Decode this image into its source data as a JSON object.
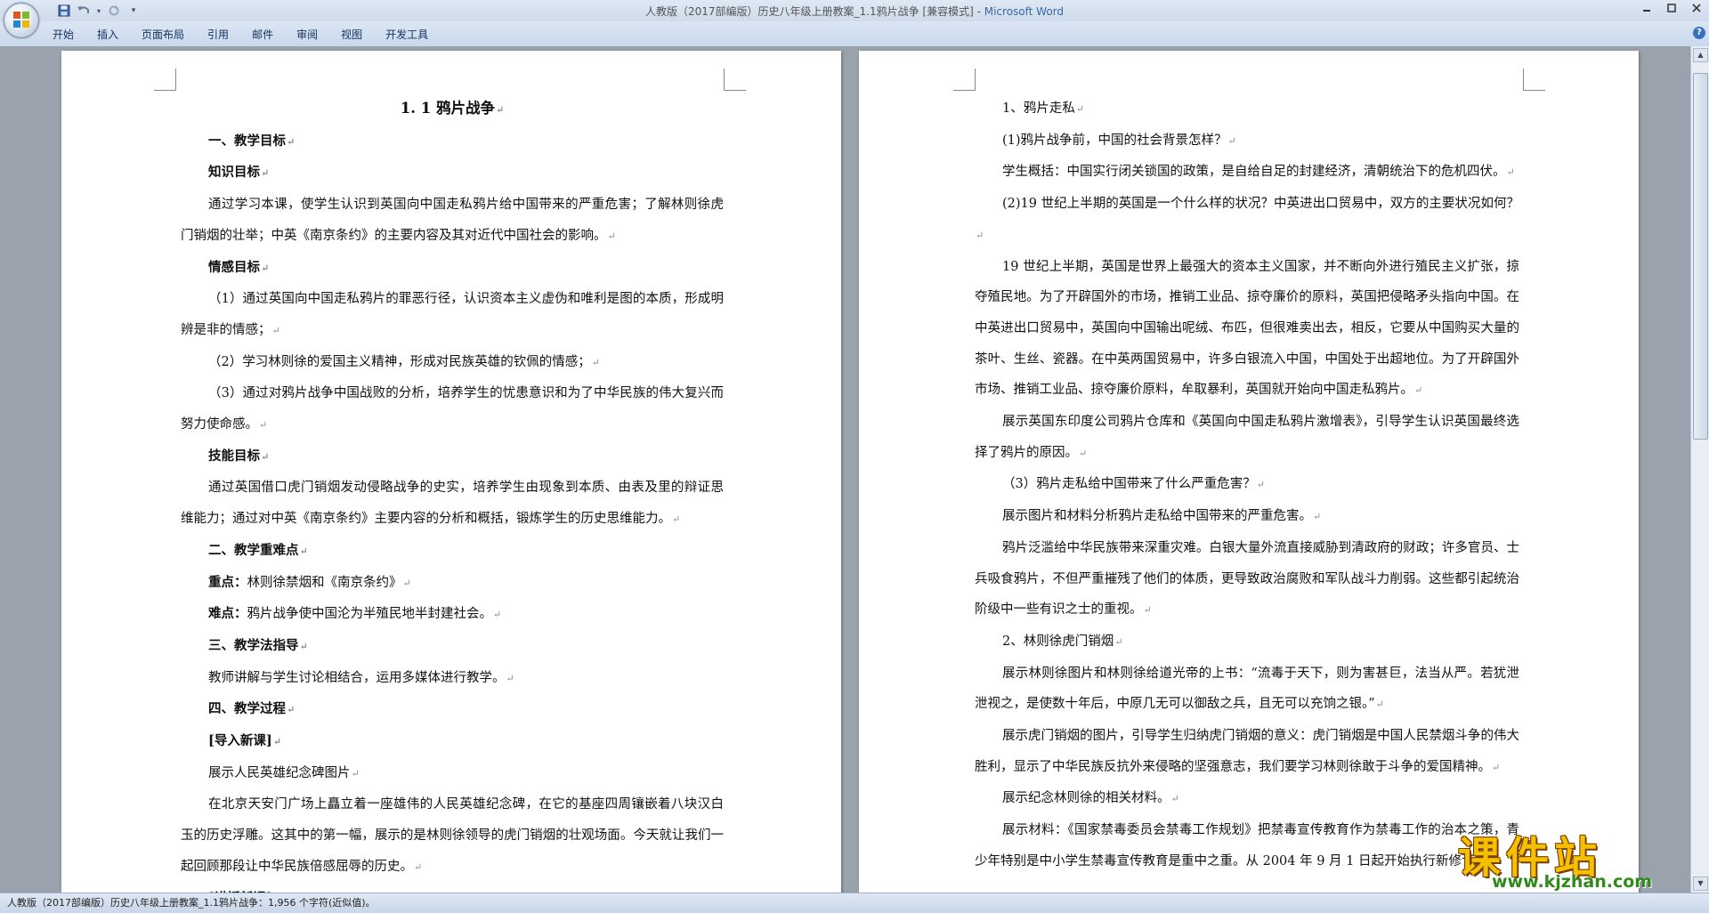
{
  "window": {
    "title_prefix": "人教版（2017部编版）历史八年级上册教案_1.1鸦片战争 [兼容模式] - ",
    "title_app": "Microsoft Word"
  },
  "ribbon": {
    "tabs": [
      "开始",
      "插入",
      "页面布局",
      "引用",
      "邮件",
      "审阅",
      "视图",
      "开发工具"
    ]
  },
  "icons": {
    "office_button": "office-logo-icon",
    "save": "save-icon",
    "undo": "undo-icon",
    "redo": "redo-icon",
    "customize": "qat-dropdown-icon",
    "help": "help-icon"
  },
  "pilcrow": "↵",
  "left_page": {
    "paragraphs": [
      {
        "text": "1. 1 鸦片战争",
        "style": "title"
      },
      {
        "text": "一、教学目标",
        "style": "b"
      },
      {
        "text": "知识目标",
        "style": "b"
      },
      {
        "text": "通过学习本课，使学生认识到英国向中国走私鸦片给中国带来的严重危害；了解林则徐虎门销烟的壮举；中英《南京条约》的主要内容及其对近代中国社会的影响。",
        "style": "normal"
      },
      {
        "text": "情感目标",
        "style": "b"
      },
      {
        "text": "（1）通过英国向中国走私鸦片的罪恶行径，认识资本主义虚伪和唯利是图的本质，形成明辨是非的情感；",
        "style": "normal"
      },
      {
        "text": "（2）学习林则徐的爱国主义精神，形成对民族英雄的钦佩的情感；",
        "style": "normal"
      },
      {
        "text": "（3）通过对鸦片战争中国战败的分析，培养学生的忧患意识和为了中华民族的伟大复兴而努力使命感。",
        "style": "normal"
      },
      {
        "text": "技能目标",
        "style": "b"
      },
      {
        "text": "通过英国借口虎门销烟发动侵略战争的史实，培养学生由现象到本质、由表及里的辩证思维能力；通过对中英《南京条约》主要内容的分析和概括，锻炼学生的历史思维能力。",
        "style": "normal"
      },
      {
        "text": "二、教学重难点",
        "style": "b"
      },
      {
        "text": "重点：林则徐禁烟和《南京条约》",
        "style": "normal",
        "lead": "重点："
      },
      {
        "text": "难点：鸦片战争使中国沦为半殖民地半封建社会。",
        "style": "normal",
        "lead": "难点："
      },
      {
        "text": "三、教学法指导",
        "style": "b"
      },
      {
        "text": "教师讲解与学生讨论相结合，运用多媒体进行教学。",
        "style": "normal"
      },
      {
        "text": "四、教学过程",
        "style": "b"
      },
      {
        "text": "[导入新课]",
        "style": "b"
      },
      {
        "text": "展示人民英雄纪念碑图片",
        "style": "normal"
      },
      {
        "text": "在北京天安门广场上矗立着一座雄伟的人民英雄纪念碑，在它的基座四周镶嵌着八块汉白玉的历史浮雕。这其中的第一幅，展示的是林则徐领导的虎门销烟的壮观场面。今天就让我们一起回顾那段让中华民族倍感屈辱的历史。",
        "style": "normal"
      },
      {
        "text": "[讲授新课]",
        "style": "b"
      }
    ]
  },
  "right_page": {
    "paragraphs": [
      {
        "text": "1、鸦片走私",
        "style": "normal"
      },
      {
        "text": "(1)鸦片战争前，中国的社会背景怎样？",
        "style": "normal"
      },
      {
        "text": "学生概括：中国实行闭关锁国的政策，是自给自足的封建经济，清朝统治下的危机四伏。",
        "style": "normal"
      },
      {
        "text": "(2)19 世纪上半期的英国是一个什么样的状况？中英进出口贸易中，双方的主要状况如何？",
        "style": "normal"
      },
      {
        "text": "19 世纪上半期，英国是世界上最强大的资本主义国家，并不断向外进行殖民主义扩张，掠夺殖民地。为了开辟国外的市场，推销工业品、掠夺廉价的原料，英国把侵略矛头指向中国。在中英进出口贸易中，英国向中国输出呢绒、布匹，但很难卖出去，相反，它要从中国购买大量的茶叶、生丝、瓷器。在中英两国贸易中，许多白银流入中国，中国处于出超地位。为了开辟国外市场、推销工业品、掠夺廉价原料，牟取暴利，英国就开始向中国走私鸦片。",
        "style": "normal"
      },
      {
        "text": "展示英国东印度公司鸦片仓库和《英国向中国走私鸦片激增表》，引导学生认识英国最终选择了鸦片的原因。",
        "style": "normal"
      },
      {
        "text": "（3）鸦片走私给中国带来了什么严重危害？",
        "style": "normal"
      },
      {
        "text": "展示图片和材料分析鸦片走私给中国带来的严重危害。",
        "style": "normal"
      },
      {
        "text": "鸦片泛滥给中华民族带来深重灾难。白银大量外流直接威胁到清政府的财政；许多官员、士兵吸食鸦片，不但严重摧残了他们的体质，更导致政治腐败和军队战斗力削弱。这些都引起统治阶级中一些有识之士的重视。",
        "style": "normal"
      },
      {
        "text": "2、林则徐虎门销烟",
        "style": "normal"
      },
      {
        "text": "展示林则徐图片和林则徐给道光帝的上书：“流毒于天下，则为害甚巨，法当从严。若犹泄泄视之，是使数十年后，中原几无可以御敌之兵，且无可以充饷之银。”",
        "style": "normal"
      },
      {
        "text": "展示虎门销烟的图片，引导学生归纳虎门销烟的意义：虎门销烟是中国人民禁烟斗争的伟大胜利，显示了中华民族反抗外来侵略的坚强意志，我们要学习林则徐敢于斗争的爱国精神。",
        "style": "normal"
      },
      {
        "text": "展示纪念林则徐的相关材料。",
        "style": "normal"
      },
      {
        "text": "展示材料：《国家禁毒委员会禁毒工作规划》把禁毒宣传教育作为禁毒工作的治本之策，青少年特别是中小学生禁毒宣传教育是重中之重。从 2004 年 9 月 1 日起开始执行新修订的",
        "style": "normal"
      }
    ]
  },
  "statusbar": {
    "text": "人教版（2017部编版）历史八年级上册教案_1.1鸦片战争：1,956 个字符(近似值)。"
  },
  "watermark": {
    "main": "课件站",
    "url": "www.kjzhan.com"
  }
}
